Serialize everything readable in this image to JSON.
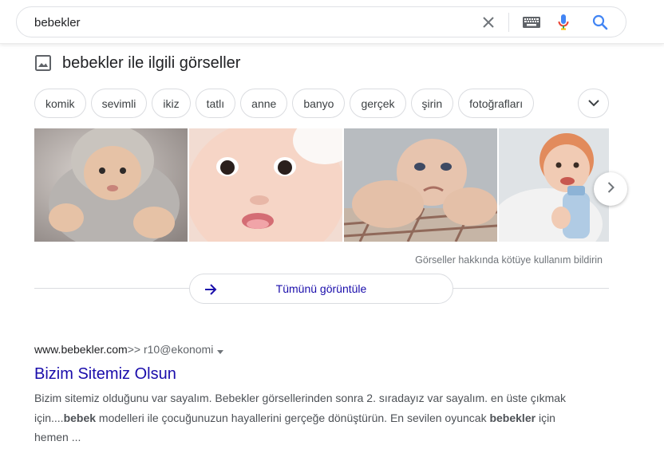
{
  "search": {
    "query": "bebekler"
  },
  "icons": {
    "clear": "close-icon",
    "keyboard": "keyboard-icon",
    "mic": "mic-icon",
    "search": "search-icon",
    "images": "image-icon",
    "next": "chevron-right-icon",
    "expand": "chevron-down-icon",
    "view_all": "arrow-right-icon"
  },
  "images_section": {
    "title": "bebekler ile ilgili görseller",
    "chips": [
      "komik",
      "sevimli",
      "ikiz",
      "tatlı",
      "anne",
      "banyo",
      "gerçek",
      "şirin",
      "fotoğrafları"
    ],
    "report": "Görseller hakkında kötüye kullanım bildirin",
    "view_all": "Tümünü görüntüle"
  },
  "result": {
    "domain": "www.bebekler.com",
    "path": ">> r10@ekonomi",
    "title": "Bizim Sitemiz Olsun",
    "snippet_1": "Bizim sitemiz olduğunu var sayalım. Bebekler görsellerinden sonra 2. sıradayız var sayalım. en üste çıkmak için....",
    "snippet_bold_1": "bebek",
    "snippet_2": " modelleri ile çocuğunuzun hayallerini gerçeğe dönüştürün. En sevilen oyuncak ",
    "snippet_bold_2": "bebekler",
    "snippet_3": " için hemen ..."
  },
  "colors": {
    "link": "#1a0dab",
    "google_blue": "#4285f4",
    "google_red": "#ea4335",
    "text_muted": "#70757a"
  }
}
